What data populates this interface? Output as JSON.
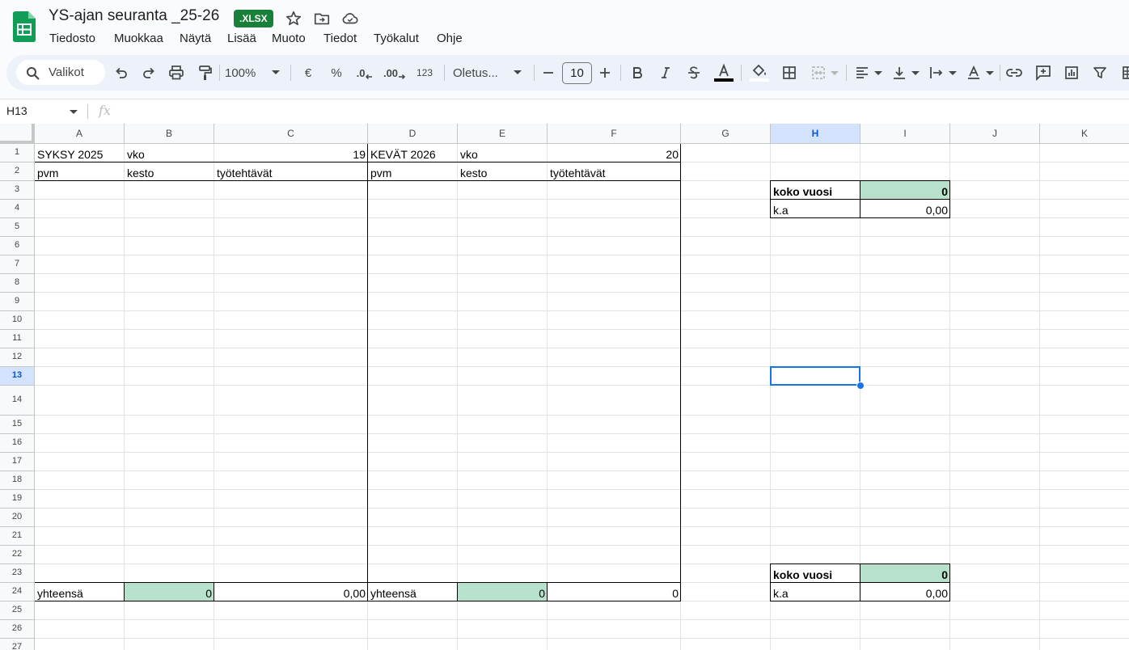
{
  "app": {
    "title": "YS-ajan seuranta _25-26",
    "badge": ".XLSX",
    "menu": [
      "Tiedosto",
      "Muokkaa",
      "Näytä",
      "Lisää",
      "Muoto",
      "Tiedot",
      "Työkalut",
      "Ohje"
    ]
  },
  "toolbar": {
    "search_label": "Valikot",
    "zoom": "100%",
    "currency": "€",
    "percent": "%",
    "number_format": "123",
    "font": "Oletus...",
    "font_size": "10",
    "dec_decrease": ".0",
    "dec_increase": ".00"
  },
  "formula_bar": {
    "name_box": "H13",
    "fx": "fx",
    "formula": ""
  },
  "columns": [
    "A",
    "B",
    "C",
    "D",
    "E",
    "F",
    "G",
    "H",
    "I",
    "J",
    "K"
  ],
  "rows": [
    "1",
    "2",
    "3",
    "4",
    "5",
    "6",
    "7",
    "8",
    "9",
    "10",
    "11",
    "12",
    "13",
    "14",
    "15",
    "16",
    "17",
    "18",
    "19",
    "20",
    "21",
    "22",
    "23",
    "24",
    "25",
    "26",
    "27"
  ],
  "selected_cell": "H13",
  "cells": {
    "A1": "SYKSY 2025",
    "B1": "vko",
    "C1": "19",
    "D1": "KEVÄT 2026",
    "E1": "vko",
    "F1": "20",
    "A2": "pvm",
    "B2": "kesto",
    "C2": "työtehtävät",
    "D2": "pvm",
    "E2": "kesto",
    "F2": "työtehtävät",
    "H3": "koko vuosi",
    "I3": "0",
    "H4": "k.a",
    "I4": "0,00",
    "H23": "koko vuosi",
    "I23": "0",
    "H24": "k.a",
    "I24": "0,00",
    "A24": "yhteensä",
    "B24": "0",
    "C24": "0,00",
    "D24": "yhteensä",
    "E24": "0",
    "F24": "0"
  },
  "colors": {
    "accent": "#1a73e8",
    "highlight_fill": "#b7e1cd",
    "badge": "#188038"
  }
}
